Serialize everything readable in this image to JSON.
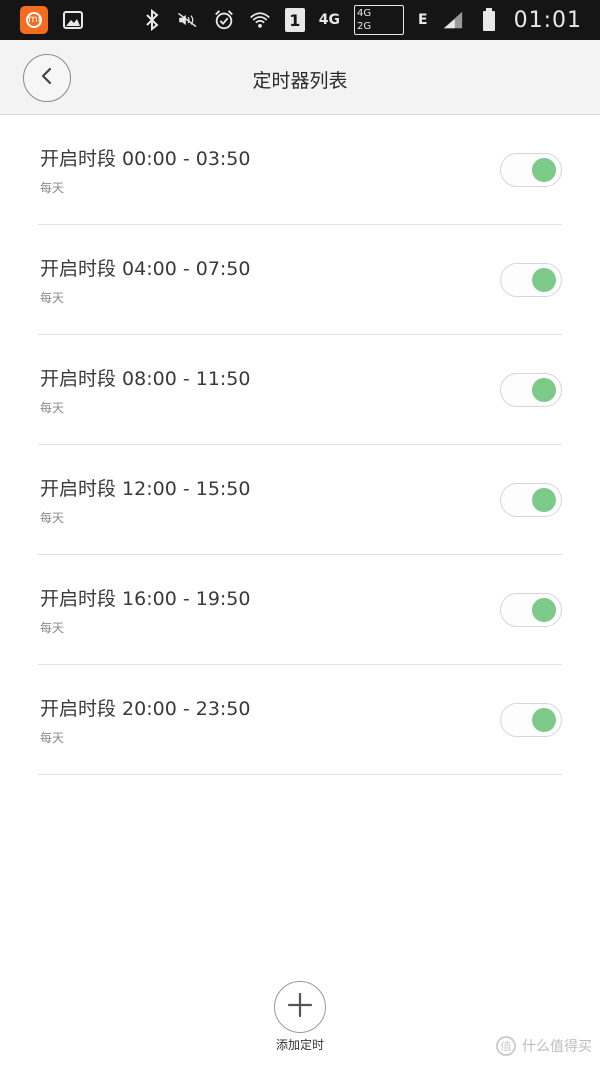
{
  "status_bar": {
    "app_badge": "mi",
    "network_1": "4G",
    "network_2_top": "4G",
    "network_2_bottom": "2G",
    "network_3": "E",
    "sim_label": "1",
    "time": "01:01",
    "icons": [
      "mi-app-icon",
      "gallery-icon",
      "bluetooth-icon",
      "mute-icon",
      "alarm-icon",
      "wifi-icon",
      "sim-icon",
      "signal-icon",
      "battery-icon"
    ]
  },
  "header": {
    "title": "定时器列表",
    "back_icon": "chevron-left-icon"
  },
  "timers": [
    {
      "label": "开启时段  00:00 - 03:50",
      "repeat": "每天",
      "enabled": true
    },
    {
      "label": "开启时段  04:00 - 07:50",
      "repeat": "每天",
      "enabled": true
    },
    {
      "label": "开启时段  08:00 - 11:50",
      "repeat": "每天",
      "enabled": true
    },
    {
      "label": "开启时段  12:00 - 15:50",
      "repeat": "每天",
      "enabled": true
    },
    {
      "label": "开启时段  16:00 - 19:50",
      "repeat": "每天",
      "enabled": true
    },
    {
      "label": "开启时段  20:00 - 23:50",
      "repeat": "每天",
      "enabled": true
    }
  ],
  "add_button": {
    "label": "添加定时",
    "icon": "plus-icon"
  },
  "watermark": {
    "badge": "值",
    "text": "什么值得买"
  },
  "colors": {
    "toggle_on": "#7cc98a",
    "status_bar_bg": "#151515",
    "header_bg": "#f3f3f3",
    "app_accent": "#f46d1f"
  }
}
